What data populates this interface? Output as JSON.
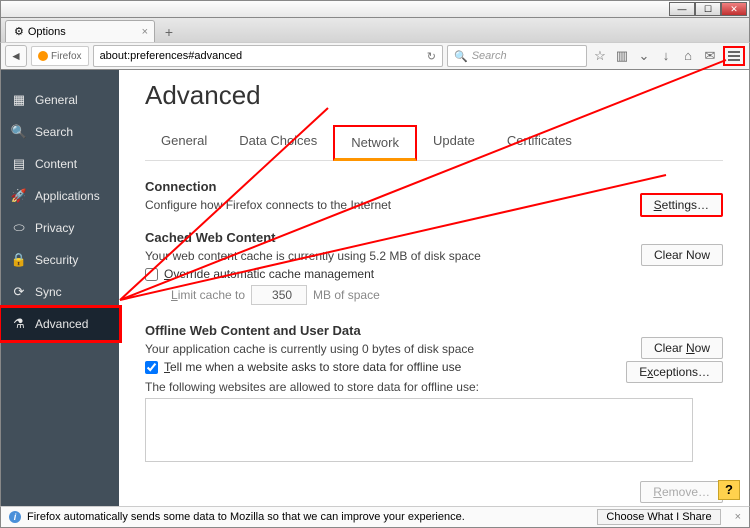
{
  "window": {
    "tab_title": "Options"
  },
  "toolbar": {
    "identity": "Firefox",
    "url": "about:preferences#advanced",
    "search_placeholder": "Search"
  },
  "sidebar": {
    "items": [
      {
        "label": "General"
      },
      {
        "label": "Search"
      },
      {
        "label": "Content"
      },
      {
        "label": "Applications"
      },
      {
        "label": "Privacy"
      },
      {
        "label": "Security"
      },
      {
        "label": "Sync"
      },
      {
        "label": "Advanced"
      }
    ]
  },
  "page": {
    "title": "Advanced",
    "tabs": [
      {
        "label": "General"
      },
      {
        "label": "Data Choices"
      },
      {
        "label": "Network"
      },
      {
        "label": "Update"
      },
      {
        "label": "Certificates"
      }
    ],
    "connection": {
      "heading": "Connection",
      "desc": "Configure how Firefox connects to the Internet",
      "settings_btn": "Settings…"
    },
    "cache": {
      "heading": "Cached Web Content",
      "desc": "Your web content cache is currently using 5.2 MB of disk space",
      "clear_btn": "Clear Now",
      "override_label": "Override automatic cache management",
      "limit_prefix": "Limit cache to",
      "limit_value": "350",
      "limit_suffix": "MB of space"
    },
    "offline": {
      "heading": "Offline Web Content and User Data",
      "desc": "Your application cache is currently using 0 bytes of disk space",
      "clear_btn": "Clear Now",
      "tell_label": "Tell me when a website asks to store data for offline use",
      "exceptions_btn": "Exceptions…",
      "allowed_label": "The following websites are allowed to store data for offline use:",
      "remove_btn": "Remove…"
    }
  },
  "footer": {
    "help": "?",
    "status_msg": "Firefox automatically sends some data to Mozilla so that we can improve your experience.",
    "choose_btn": "Choose What I Share"
  }
}
